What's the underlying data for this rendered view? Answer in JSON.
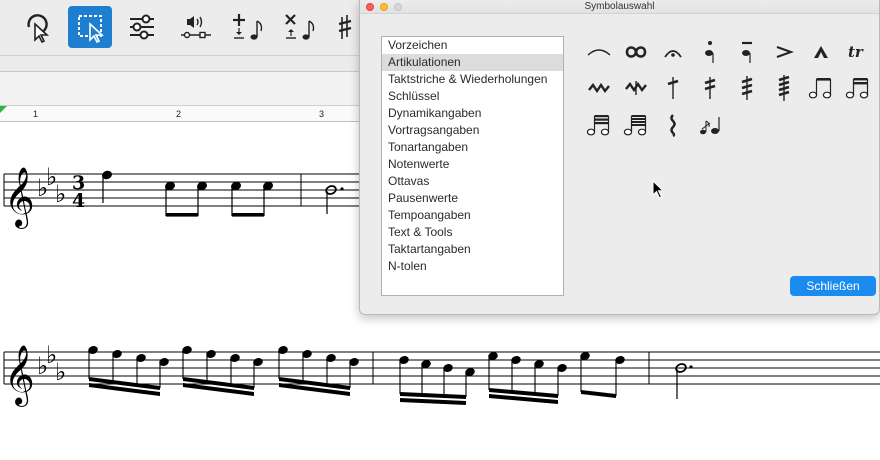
{
  "toolbar": {
    "tools": [
      {
        "name": "lasso-select-icon"
      },
      {
        "name": "rect-select-icon",
        "selected": true
      },
      {
        "name": "mixer-icon"
      },
      {
        "name": "playback-icon"
      },
      {
        "name": "add-note-icon"
      },
      {
        "name": "delete-note-icon"
      }
    ]
  },
  "ruler": {
    "marks": [
      "1",
      "2",
      "3"
    ]
  },
  "dialog": {
    "title": "Symbolauswahl",
    "categories": [
      "Vorzeichen",
      "Artikulationen",
      "Taktstriche & Wiederholungen",
      "Schlüssel",
      "Dynamikangaben",
      "Vortragsangaben",
      "Tonartangaben",
      "Notenwerte",
      "Ottavas",
      "Pausenwerte",
      "Tempoangaben",
      "Text & Tools",
      "Taktartangaben",
      "N-tolen"
    ],
    "selected_index": 1,
    "symbols": [
      {
        "name": "tie-icon",
        "glyph": "⁀"
      },
      {
        "name": "turn-icon",
        "glyph": "∞"
      },
      {
        "name": "fermata-icon",
        "glyph": "𝄐"
      },
      {
        "name": "staccato-icon",
        "glyph": ""
      },
      {
        "name": "tenuto-icon",
        "glyph": ""
      },
      {
        "name": "accent-icon",
        "glyph": ">"
      },
      {
        "name": "marcato-icon",
        "glyph": "^"
      },
      {
        "name": "trill-icon",
        "glyph": "tr"
      },
      {
        "name": "mordent-icon",
        "glyph": ""
      },
      {
        "name": "inverted-mordent-icon",
        "glyph": ""
      },
      {
        "name": "tremolo-1-icon",
        "glyph": ""
      },
      {
        "name": "tremolo-2-icon",
        "glyph": ""
      },
      {
        "name": "tremolo-3-icon",
        "glyph": ""
      },
      {
        "name": "tremolo-4-icon",
        "glyph": ""
      },
      {
        "name": "beam-8th-icon",
        "glyph": ""
      },
      {
        "name": "beam-16th-icon",
        "glyph": ""
      },
      {
        "name": "beam-32nd-icon",
        "glyph": ""
      },
      {
        "name": "beam-64th-icon",
        "glyph": ""
      },
      {
        "name": "arpeggio-icon",
        "glyph": ""
      },
      {
        "name": "grace-note-icon",
        "glyph": ""
      }
    ],
    "close_label": "Schließen"
  },
  "score": {
    "time_signature": {
      "top": "3",
      "bottom": "4"
    }
  },
  "colors": {
    "accent": "#1a8cf0",
    "selected_tool": "#1e7fd0"
  }
}
